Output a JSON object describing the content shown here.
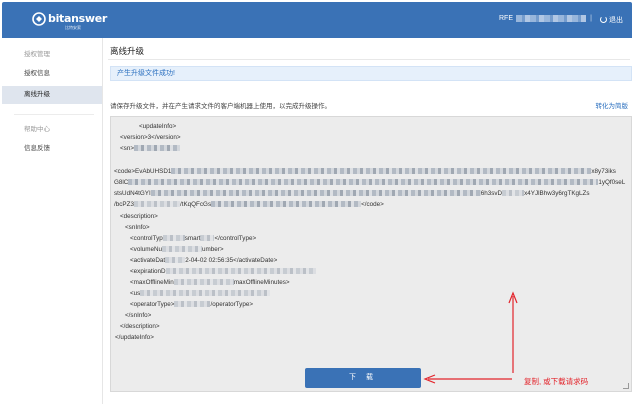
{
  "header": {
    "brand": "bitanswer",
    "brand_sub": "比特安索",
    "user_prefix": "RFE",
    "separator": "|",
    "logout_label": "退出",
    "colors": {
      "bar": "#3a72b6",
      "accent": "#2a6fbf"
    }
  },
  "sidebar": {
    "groups": [
      {
        "title": "授权管理",
        "items": [
          "授权信息",
          "离线升级"
        ]
      },
      {
        "title": "帮助中心",
        "items": [
          "信息反馈"
        ]
      }
    ],
    "active_item": "离线升级"
  },
  "main": {
    "page_title": "离线升级",
    "alert_message": "产生升级文件成功!",
    "hint": "请保存升级文件，并在产生请求文件的客户端机器上使用，以完成升级操作。",
    "simplify_link": "转化为简版",
    "code": {
      "l1": "<updateInfo>",
      "l2": "<version>3</version>",
      "l3a": "<sn>",
      "l4a": "<code>EvAbUHSD1",
      "l4b": "x8y73iks",
      "l5a": "G8lC",
      "l5b": "1yQf0seL",
      "l6a": "stsUdN4tGYI",
      "l6b": "6h3svD",
      "l6c": "x4YJlBhw3y6rgTKgLZs",
      "l7a": "/bcPZ3",
      "l7b": "/tKqQFcGs",
      "l7c": "</code>",
      "l8": "<description>",
      "l9": "<snInfo>",
      "l10a": "<controlTyp",
      "l10b": "smart",
      "l10c": "</controlType>",
      "l11a": "<volumeNu",
      "l11b": "umber>",
      "l12a": "<activateDat",
      "l12b": "2-04-02 02:56:35</activateDate>",
      "l13a": "<expirationD",
      "l14a": "<maxOfflineMin",
      "l14b": "maxOfflineMinutes>",
      "l15a": "<us",
      "l16a": "<operatorType>",
      "l16b": "/operatorType>",
      "l17": "</snInfo>",
      "l18": "</description>",
      "l19": "</updateInfo>"
    },
    "download_label": "下 载",
    "annotation": "复制, 或下载请求码"
  }
}
